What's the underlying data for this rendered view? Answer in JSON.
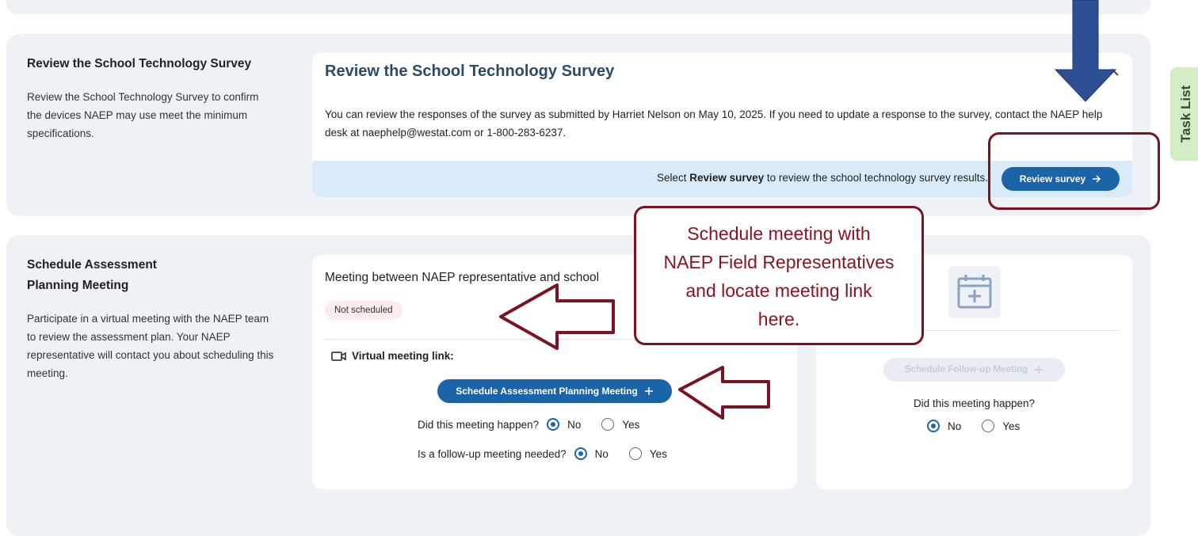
{
  "review_section": {
    "side_title": "Review the School Technology Survey",
    "side_description": "Review the School Technology Survey to confirm the devices NAEP may use meet the minimum specifications.",
    "card_title": "Review the School Technology Survey",
    "card_body": "You can review the responses of the survey as submitted by Harriet Nelson on May 10, 2025. If you need to update a response to the survey, contact the NAEP help desk at naephelp@westat.com or 1-800-283-6237.",
    "footer_prefix": "Select ",
    "footer_bold": "Review survey",
    "footer_suffix": " to review the school technology survey results.",
    "review_button_label": "Review survey"
  },
  "meeting_section": {
    "side_title_line1": "Schedule Assessment",
    "side_title_line2": "Planning Meeting",
    "side_description": "Participate in a virtual meeting with the NAEP team to review the assessment plan. Your NAEP representative will contact you about scheduling this meeting.",
    "card_title": "Meeting between NAEP representative and school",
    "status_badge": "Not scheduled",
    "virtual_link_label": "Virtual meeting link:",
    "schedule_button_label": "Schedule Assessment Planning Meeting",
    "q_happened": "Did this meeting happen?",
    "q_followup": "Is a follow-up meeting needed?",
    "option_no": "No",
    "option_yes": "Yes",
    "happened_selected": "No",
    "followup_selected": "No"
  },
  "followup_card": {
    "button_label": "Schedule Follow-up Meeting",
    "question": "Did this meeting happen?",
    "option_no": "No",
    "option_yes": "Yes",
    "selected": "No"
  },
  "task_list_tab": "Task List",
  "annotation": {
    "callout_line1": "Schedule meeting with",
    "callout_line2": "NAEP Field Representatives",
    "callout_line3": "and locate meeting link",
    "callout_line4": "here."
  },
  "colors": {
    "accent_blue": "#1c64a8",
    "annotation_red": "#7b1320",
    "task_tab_green": "#d2ecc4",
    "arrow_blue": "#2f4f95"
  }
}
